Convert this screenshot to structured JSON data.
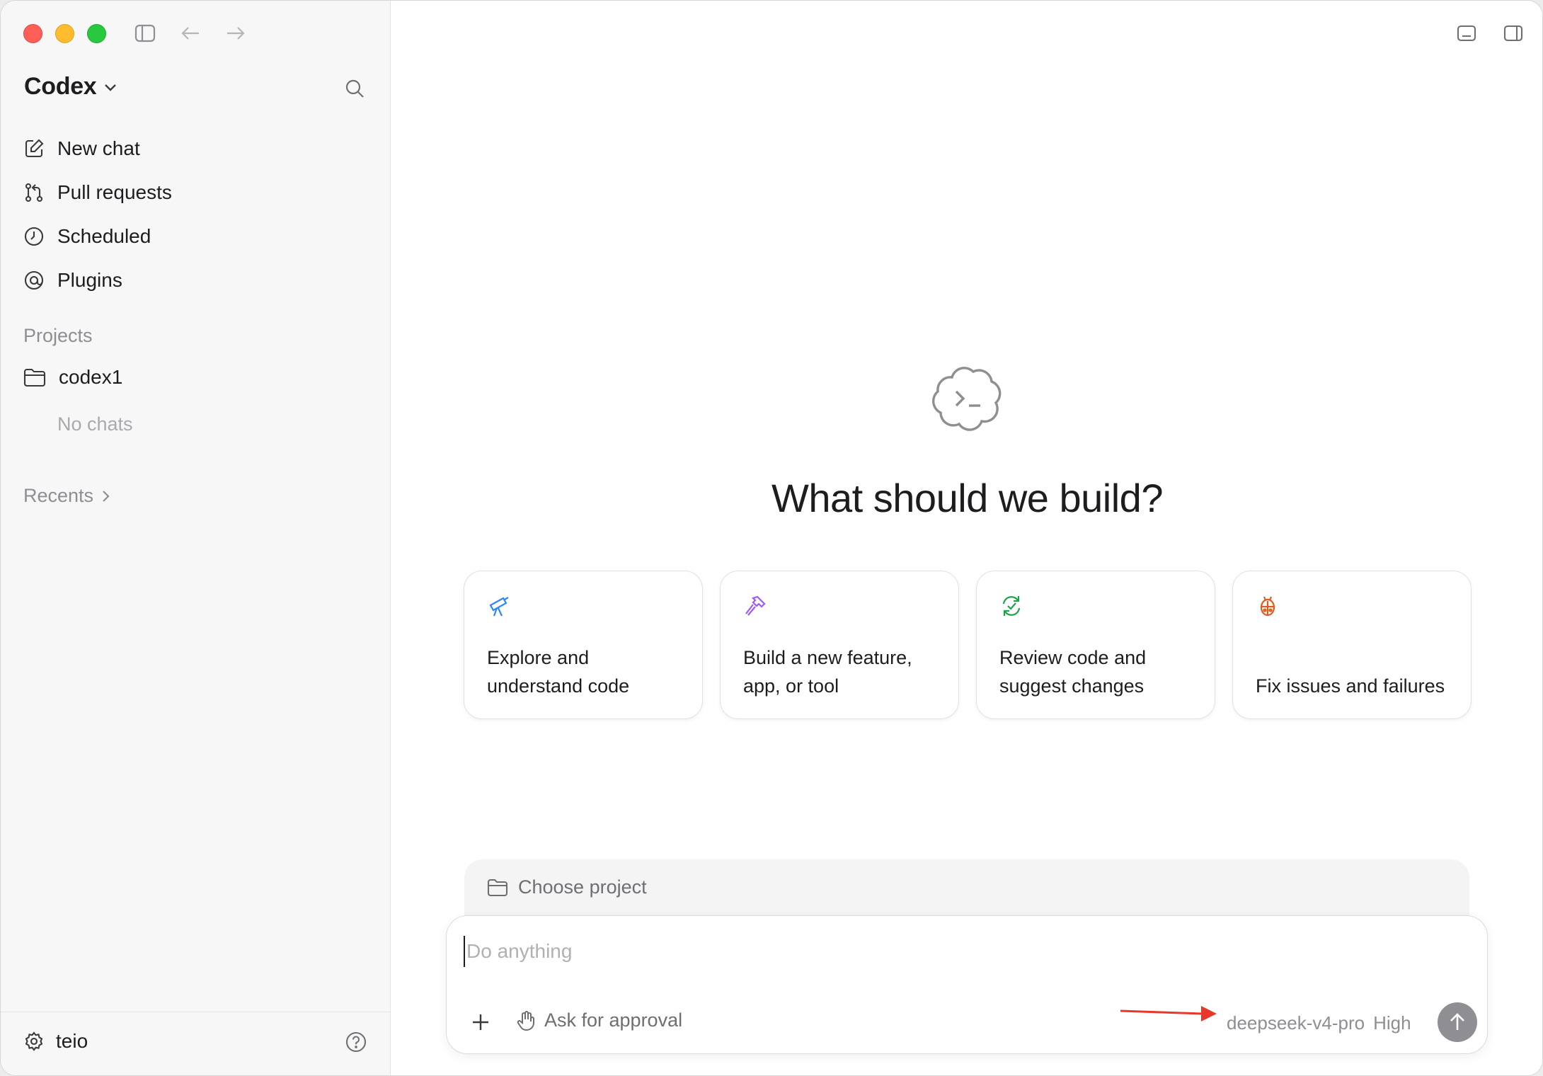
{
  "sidebar": {
    "brand": "Codex",
    "menu": [
      {
        "label": "New chat",
        "icon": "compose-icon"
      },
      {
        "label": "Pull requests",
        "icon": "pull-request-icon"
      },
      {
        "label": "Scheduled",
        "icon": "clock-icon"
      },
      {
        "label": "Plugins",
        "icon": "plugin-icon"
      }
    ],
    "projects_label": "Projects",
    "projects": [
      {
        "name": "codex1",
        "empty_text": "No chats"
      }
    ],
    "recents_label": "Recents",
    "user_name": "teio"
  },
  "main": {
    "hero_title": "What should we build?",
    "cards": [
      {
        "label": "Explore and understand code",
        "icon": "telescope-icon",
        "color": "#2f86f6"
      },
      {
        "label": "Build a new feature, app, or tool",
        "icon": "hammer-icon",
        "color": "#9b5cf6"
      },
      {
        "label": "Review code and suggest changes",
        "icon": "review-cycle-icon",
        "color": "#1fa34a"
      },
      {
        "label": "Fix issues and failures",
        "icon": "bug-icon",
        "color": "#e25a1c"
      }
    ],
    "project_picker": "Choose project",
    "composer": {
      "placeholder": "Do anything",
      "approval_label": "Ask for approval",
      "model": "deepseek-v4-pro",
      "effort": "High"
    }
  },
  "colors": {
    "annotation_arrow": "#e8382c",
    "send_button": "#8e8e93"
  }
}
